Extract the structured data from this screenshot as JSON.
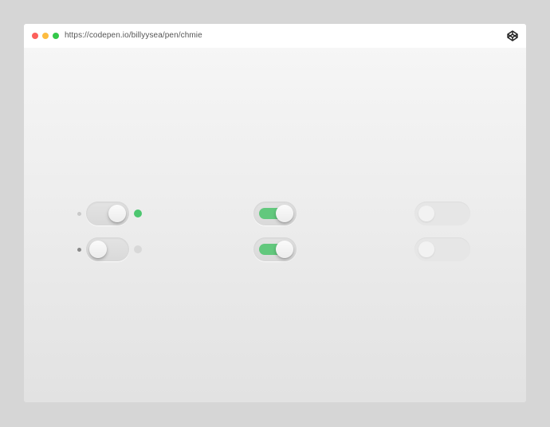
{
  "browser": {
    "url": "https://codepen.io/billyysea/pen/chmie"
  },
  "colors": {
    "accent_green": "#4cc66f",
    "track_green": "#62c87d",
    "dot_red": "#fc605b",
    "dot_yellow": "#fdbc40",
    "dot_green": "#34c84a"
  },
  "toggles": [
    {
      "id": "col1-row1",
      "state": "on",
      "indicator": "green"
    },
    {
      "id": "col1-row2",
      "state": "off",
      "indicator": "grey"
    },
    {
      "id": "col2-row1",
      "state": "on"
    },
    {
      "id": "col2-row2",
      "state": "on"
    },
    {
      "id": "col3-row1",
      "state": "off"
    },
    {
      "id": "col3-row2",
      "state": "off"
    }
  ]
}
